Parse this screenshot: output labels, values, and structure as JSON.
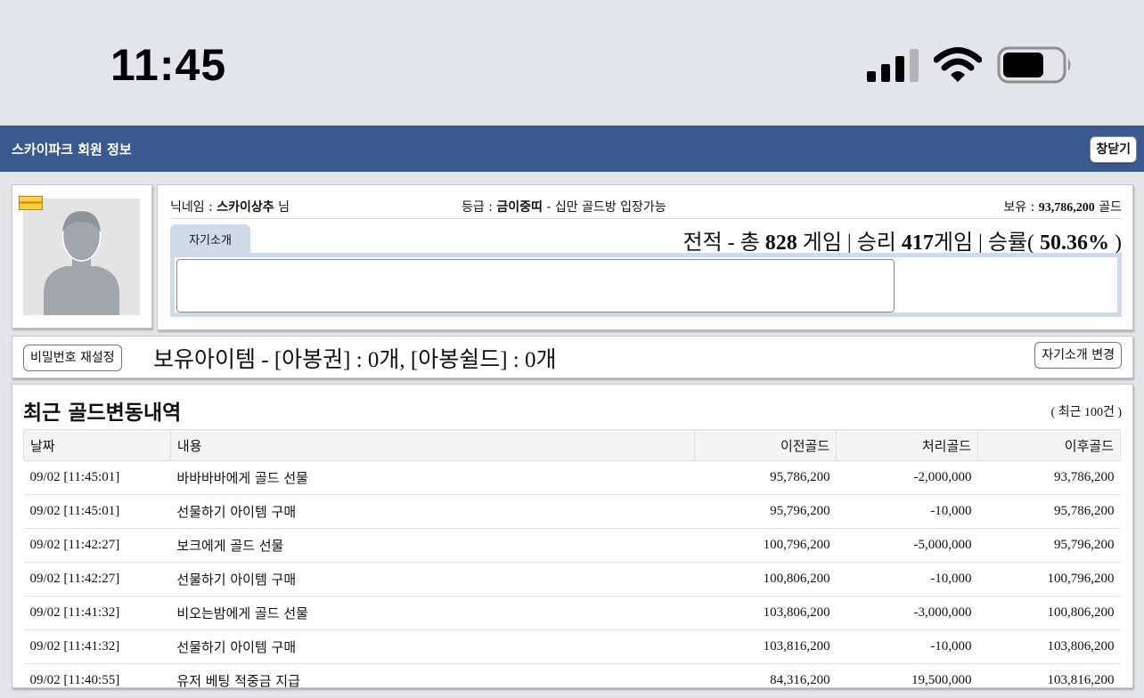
{
  "status_bar": {
    "time": "11:45",
    "icons": [
      "cellular-signal-icon",
      "wifi-icon",
      "battery-icon"
    ]
  },
  "window": {
    "title": "스카이파크 회원 정보",
    "close_label": "창닫기"
  },
  "profile": {
    "nickname_label": "닉네임 : ",
    "nickname": "스카이상추",
    "nickname_suffix": " 님",
    "grade_label": "등급 : ",
    "grade": "금이중띠",
    "grade_desc": " - 십만 골드방 입장가능",
    "holding_label": "보유 : ",
    "holding_gold": "93,786,200",
    "holding_unit": " 골드",
    "intro_tab": "자기소개",
    "stats": {
      "prefix": "전적 - 총 ",
      "total": "828",
      "games_label": " 게임 | 승리 ",
      "wins": "417",
      "wins_label": "게임 | 승률( ",
      "rate": "50.36%",
      "suffix": " )"
    }
  },
  "items": {
    "reset_password": "비밀번호 재설정",
    "text": "보유아이템 - [아봉권] : 0개, [아봉쉴드] : 0개",
    "change_intro": "자기소개 변경"
  },
  "history": {
    "title": "최근 골드변동내역",
    "note": "( 최근 100건 )",
    "columns": [
      "날짜",
      "내용",
      "이전골드",
      "처리골드",
      "이후골드"
    ],
    "rows": [
      {
        "date": "09/02 [11:45:01]",
        "desc": "바바바바에게 골드 선물",
        "before": "95,786,200",
        "change": "-2,000,000",
        "after": "93,786,200"
      },
      {
        "date": "09/02 [11:45:01]",
        "desc": "선물하기 아이템 구매",
        "before": "95,796,200",
        "change": "-10,000",
        "after": "95,786,200"
      },
      {
        "date": "09/02 [11:42:27]",
        "desc": "보크에게 골드 선물",
        "before": "100,796,200",
        "change": "-5,000,000",
        "after": "95,796,200"
      },
      {
        "date": "09/02 [11:42:27]",
        "desc": "선물하기 아이템 구매",
        "before": "100,806,200",
        "change": "-10,000",
        "after": "100,796,200"
      },
      {
        "date": "09/02 [11:41:32]",
        "desc": "비오는밤에게 골드 선물",
        "before": "103,806,200",
        "change": "-3,000,000",
        "after": "100,806,200"
      },
      {
        "date": "09/02 [11:41:32]",
        "desc": "선물하기 아이템 구매",
        "before": "103,816,200",
        "change": "-10,000",
        "after": "103,806,200"
      },
      {
        "date": "09/02 [11:40:55]",
        "desc": "유저 베팅 적중금 지급",
        "before": "84,316,200",
        "change": "19,500,000",
        "after": "103,816,200"
      }
    ]
  }
}
